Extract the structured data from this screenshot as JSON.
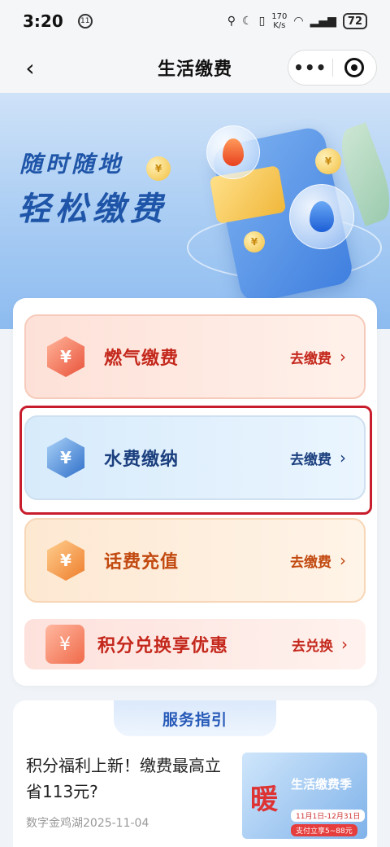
{
  "status_bar": {
    "time": "3:20",
    "notif_icon": "11",
    "net_speed_value": "170",
    "net_speed_unit": "K/s",
    "battery": "72"
  },
  "nav": {
    "title": "生活缴费",
    "back_icon": "chevron-left-icon",
    "more_icon": "more-dots-icon",
    "close_icon": "target-close-icon"
  },
  "banner": {
    "line1": "随时随地",
    "line2": "轻松缴费",
    "coin_symbol": "¥"
  },
  "services": [
    {
      "name": "燃气缴费",
      "action": "去缴费",
      "icon": "flame-icon",
      "glyph": "¥"
    },
    {
      "name": "水费缴纳",
      "action": "去缴费",
      "icon": "water-drop-icon",
      "glyph": "¥"
    },
    {
      "name": "话费充值",
      "action": "去缴费",
      "icon": "phone-recharge-icon",
      "glyph": "¥"
    },
    {
      "name": "积分兑换享优惠",
      "action": "去兑换",
      "icon": "gift-coins-icon",
      "glyph": "¥"
    }
  ],
  "guide": {
    "title": "服务指引",
    "article": {
      "title": "积分福利上新！缴费最高立省113元?",
      "source_date": "数字金鸡湖2025-11-04",
      "thumb_big": "暖",
      "thumb_small": "生活缴费季",
      "thumb_pill": "11月1日-12月31日",
      "thumb_bar": "支付立享5~88元"
    }
  },
  "colors": {
    "gas_red": "#c4271b",
    "water_blue": "#1b3f7e",
    "phone_orange": "#c24a10",
    "highlight_border": "#c81d2c"
  }
}
